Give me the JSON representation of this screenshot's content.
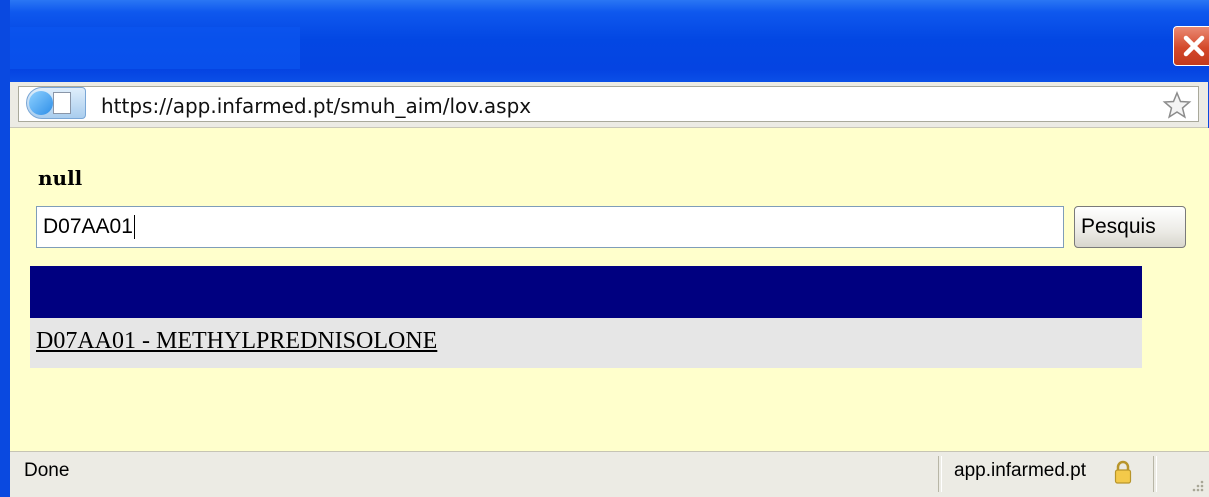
{
  "window": {
    "title": ""
  },
  "address_bar": {
    "url": "https://app.infarmed.pt/smuh_aim/lov.aspx",
    "site_icon": "globe-page-icon",
    "bookmark_icon": "star-icon"
  },
  "form": {
    "label": "null",
    "search_value": "D07AA01",
    "search_button_label": "Pesquis"
  },
  "results": {
    "header_color": "#000080",
    "items": [
      {
        "label": "D07AA01 - METHYLPREDNISOLONE"
      }
    ]
  },
  "status_bar": {
    "status": "Done",
    "domain": "app.infarmed.pt",
    "security_icon": "lock-icon"
  },
  "colors": {
    "content_background": "#ffffcc",
    "title_bar": "#0347e3",
    "close_button": "#d4492b"
  }
}
